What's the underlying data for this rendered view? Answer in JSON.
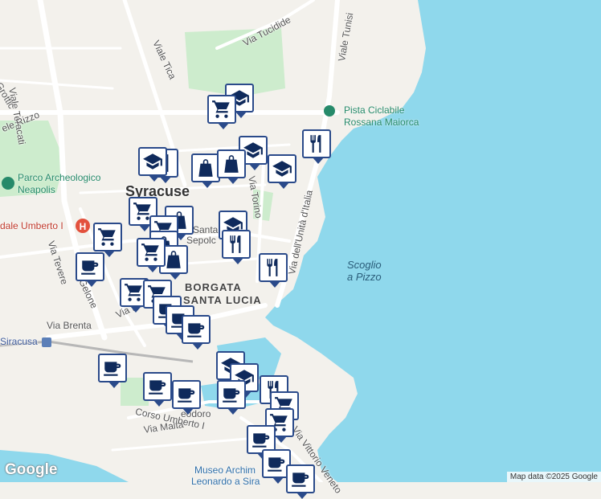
{
  "map": {
    "colors": {
      "water": "#8fd8ec",
      "land": "#f3f1ec",
      "park": "#cdeccd",
      "road": "#ffffff",
      "marker_border": "#2a4a8a",
      "poi": "#268a6a",
      "hospital": "#e3513d"
    },
    "city_label": "Syracuse",
    "district_label_1": "BORGATA",
    "district_label_2": "SANTA LUCIA",
    "sea_label_1": "Scoglio",
    "sea_label_2": "a Pizzo",
    "park_label_1": "Parco Archeologico",
    "park_label_2": "Neapolis",
    "poi_label_1": "Pista Ciclabile",
    "poi_label_2": "Rossana Maiorca",
    "hospital_label": "dale Umberto I",
    "station_label": "Siracusa",
    "church_label_1": "Santa",
    "church_label_2": "Sepolc",
    "museum_label_1": "Museo Archim",
    "museum_label_2": "Leonardo a Sira",
    "streets": {
      "viale_teracati": "Viale Teracati",
      "viale_tica": "Viale Tica",
      "via_tucidide": "Via Tucidide",
      "viale_tunisi": "Viale Tunisi",
      "via_torino": "Via Torino",
      "via_unita": "Via dell'Unità d'Italia",
      "via_tevere": "Via Tevere",
      "via_gelone": "Gelone",
      "via_brenta": "Via Brenta",
      "via_malta": "Via Malta",
      "corso_umberto": "Corso Umberto I",
      "via_vittorio_veneto": "Via Vittorio Veneto",
      "via_grottic": "Grottic",
      "via_rizzo": "ele Rizzo",
      "via_mu": "Via Mu",
      "via_teodoro": "eodoro"
    },
    "brand": "Google",
    "credit": "Map data ©2025 Google"
  },
  "markers": [
    {
      "type": "education",
      "icon": "graduation-cap-icon"
    },
    {
      "type": "shopping",
      "icon": "shopping-cart-icon"
    },
    {
      "type": "restaurant",
      "icon": "fork-knife-icon"
    },
    {
      "type": "education",
      "icon": "graduation-cap-icon"
    },
    {
      "type": "education",
      "icon": "graduation-cap-icon"
    },
    {
      "type": "restaurant",
      "icon": "fork-knife-icon"
    },
    {
      "type": "shopping",
      "icon": "shopping-bag-icon"
    },
    {
      "type": "shopping",
      "icon": "shopping-bag-icon"
    },
    {
      "type": "education",
      "icon": "graduation-cap-icon"
    },
    {
      "type": "shopping",
      "icon": "shopping-cart-icon"
    },
    {
      "type": "shopping",
      "icon": "shopping-bag-icon"
    },
    {
      "type": "shopping",
      "icon": "shopping-cart-icon"
    },
    {
      "type": "education",
      "icon": "graduation-cap-icon"
    },
    {
      "type": "restaurant",
      "icon": "fork-knife-icon"
    },
    {
      "type": "shopping",
      "icon": "shopping-cart-icon"
    },
    {
      "type": "shopping",
      "icon": "shopping-bag-icon"
    },
    {
      "type": "restaurant",
      "icon": "fork-knife-icon"
    },
    {
      "type": "cafe",
      "icon": "coffee-cup-icon"
    },
    {
      "type": "shopping",
      "icon": "shopping-bag-icon"
    },
    {
      "type": "shopping",
      "icon": "shopping-cart-icon"
    },
    {
      "type": "shopping",
      "icon": "shopping-cart-icon"
    },
    {
      "type": "shopping",
      "icon": "shopping-cart-icon"
    },
    {
      "type": "cafe",
      "icon": "coffee-cup-icon"
    },
    {
      "type": "cafe",
      "icon": "coffee-cup-icon"
    },
    {
      "type": "cafe",
      "icon": "coffee-cup-icon"
    },
    {
      "type": "cafe",
      "icon": "coffee-cup-icon"
    },
    {
      "type": "education",
      "icon": "graduation-cap-icon"
    },
    {
      "type": "education",
      "icon": "graduation-cap-icon"
    },
    {
      "type": "cafe",
      "icon": "coffee-cup-icon"
    },
    {
      "type": "cafe",
      "icon": "coffee-cup-icon"
    },
    {
      "type": "restaurant",
      "icon": "fork-knife-icon"
    },
    {
      "type": "cafe",
      "icon": "coffee-cup-icon"
    },
    {
      "type": "shopping",
      "icon": "shopping-cart-icon"
    },
    {
      "type": "shopping",
      "icon": "shopping-cart-icon"
    },
    {
      "type": "cafe",
      "icon": "coffee-cup-icon"
    },
    {
      "type": "cafe",
      "icon": "coffee-cup-icon"
    },
    {
      "type": "cafe",
      "icon": "coffee-cup-icon"
    }
  ]
}
